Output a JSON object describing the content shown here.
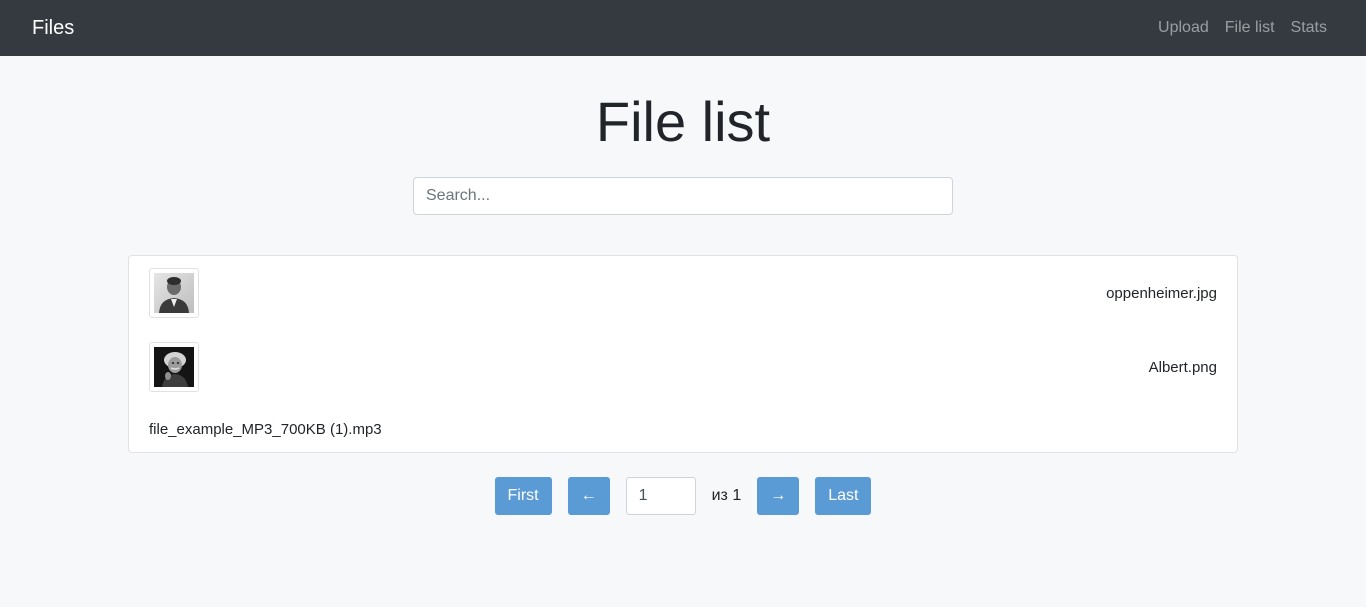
{
  "navbar": {
    "brand": "Files",
    "links": [
      "Upload",
      "File list",
      "Stats"
    ]
  },
  "main": {
    "title": "File list",
    "search_placeholder": "Search..."
  },
  "files": [
    {
      "name": "oppenheimer.jpg",
      "thumbnail": "portrait-photo"
    },
    {
      "name": "Albert.png",
      "thumbnail": "portrait-photo"
    },
    {
      "name": "file_example_MP3_700KB (1).mp3",
      "thumbnail": null
    }
  ],
  "pagination": {
    "first": "First",
    "prev": "←",
    "current_page": "1",
    "of_text": "из 1",
    "next": "→",
    "last": "Last"
  }
}
